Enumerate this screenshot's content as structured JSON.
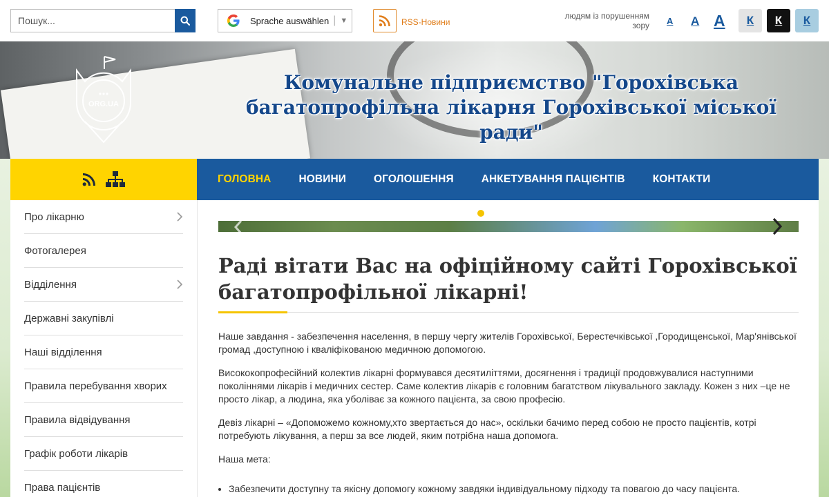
{
  "header": {
    "search_placeholder": "Пошук...",
    "translate_label": "Sprache auswählen",
    "rss_label": "RSS-Новини",
    "vision_label": "людям із порушенням зору",
    "font_sizes": [
      "A",
      "A",
      "A"
    ],
    "contrast_options": [
      "К",
      "К",
      "К"
    ]
  },
  "banner": {
    "logo_text": "ORG.UA",
    "title": "Комунальне підприємство \"Горохівська багатопрофільна лікарня Горохівської міської ради\""
  },
  "nav": {
    "items": [
      "ГОЛОВНА",
      "НОВИНИ",
      "ОГОЛОШЕННЯ",
      "АНКЕТУВАННЯ ПАЦІЄНТІВ",
      "КОНТАКТИ"
    ],
    "active_index": 0
  },
  "sidebar": {
    "items": [
      {
        "label": "Про лікарню",
        "has_submenu": true
      },
      {
        "label": "Фотогалерея",
        "has_submenu": false
      },
      {
        "label": "Відділення",
        "has_submenu": true
      },
      {
        "label": "Державні закупівлі",
        "has_submenu": false
      },
      {
        "label": "Наші відділення",
        "has_submenu": false
      },
      {
        "label": "Правила перебування хворих",
        "has_submenu": false
      },
      {
        "label": "Правила відвідування",
        "has_submenu": false
      },
      {
        "label": "Графік роботи лікарів",
        "has_submenu": false
      },
      {
        "label": "Права пацієнтів",
        "has_submenu": false
      }
    ]
  },
  "main": {
    "heading": "Раді вітати Вас на офіційному сайті Горохівської багатопрофільної лікарні!",
    "paragraphs": [
      "Наше завдання - забезпечення населення, в першу чергу жителів Горохівської, Берестечківської ,Городищенської, Мар'янівської громад ,доступною і кваліфікованою медичною допомогою.",
      "Висококопрофесійний колектив лікарні формувався десятиліттями, досягнення і традиції продовжувалися наступними поколіннями лікарів і медичних сестер. Саме колектив лікарів є головним багатством лікувального закладу. Кожен з них –це не просто лікар, а людина, яка уболіває за кожного пацієнта, за свою професію.",
      "Девіз лікарні – «Допоможемо кожному,хто звертається до нас», оскільки бачимо перед собою не просто пацієнтів, котрі потребують лікування, а перш за все людей, яким потрібна наша допомога.",
      "Наша мета:"
    ],
    "list": [
      "Забезпечити доступну та якісну допомогу кожному завдяки індивідуальному підходу та повагою до часу пацієнта."
    ]
  },
  "colors": {
    "primary": "#1a5a9e",
    "accent": "#ffd400",
    "rss": "#e07d1a"
  }
}
